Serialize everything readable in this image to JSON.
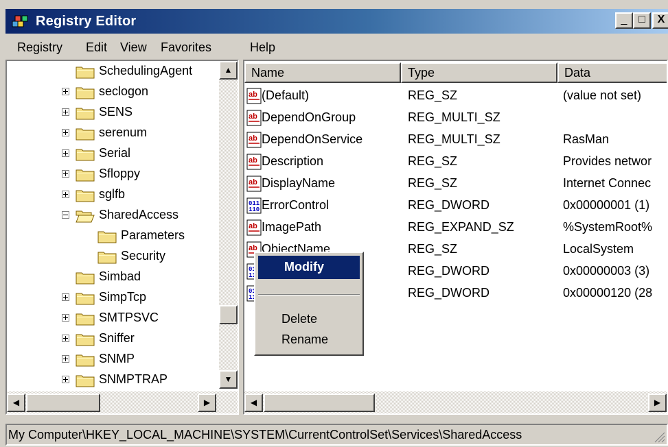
{
  "window": {
    "title": "Registry Editor",
    "minimize": "_",
    "maximize": "□",
    "close": "X"
  },
  "menu": [
    "Registry",
    "Edit",
    "View",
    "Favorites",
    "Help"
  ],
  "tree": [
    {
      "label": "SchedulingAgent",
      "expander": "none",
      "indent": 0,
      "open": false
    },
    {
      "label": "seclogon",
      "expander": "plus",
      "indent": 0,
      "open": false
    },
    {
      "label": "SENS",
      "expander": "plus",
      "indent": 0,
      "open": false
    },
    {
      "label": "serenum",
      "expander": "plus",
      "indent": 0,
      "open": false
    },
    {
      "label": "Serial",
      "expander": "plus",
      "indent": 0,
      "open": false
    },
    {
      "label": "Sfloppy",
      "expander": "plus",
      "indent": 0,
      "open": false
    },
    {
      "label": "sglfb",
      "expander": "plus",
      "indent": 0,
      "open": false
    },
    {
      "label": "SharedAccess",
      "expander": "minus",
      "indent": 0,
      "open": true
    },
    {
      "label": "Parameters",
      "expander": "none",
      "indent": 1,
      "open": false
    },
    {
      "label": "Security",
      "expander": "none",
      "indent": 1,
      "open": false
    },
    {
      "label": "Simbad",
      "expander": "none",
      "indent": 0,
      "open": false
    },
    {
      "label": "SimpTcp",
      "expander": "plus",
      "indent": 0,
      "open": false
    },
    {
      "label": "SMTPSVC",
      "expander": "plus",
      "indent": 0,
      "open": false
    },
    {
      "label": "Sniffer",
      "expander": "plus",
      "indent": 0,
      "open": false
    },
    {
      "label": "SNMP",
      "expander": "plus",
      "indent": 0,
      "open": false
    },
    {
      "label": "SNMPTRAP",
      "expander": "plus",
      "indent": 0,
      "open": false
    }
  ],
  "columns": {
    "name": "Name",
    "type": "Type",
    "data": "Data"
  },
  "values": [
    {
      "icon": "ab",
      "name": "(Default)",
      "type": "REG_SZ",
      "data": "(value not set)"
    },
    {
      "icon": "ab",
      "name": "DependOnGroup",
      "type": "REG_MULTI_SZ",
      "data": ""
    },
    {
      "icon": "ab",
      "name": "DependOnService",
      "type": "REG_MULTI_SZ",
      "data": "RasMan"
    },
    {
      "icon": "ab",
      "name": "Description",
      "type": "REG_SZ",
      "data": "Provides networ"
    },
    {
      "icon": "ab",
      "name": "DisplayName",
      "type": "REG_SZ",
      "data": "Internet Connec"
    },
    {
      "icon": "bin",
      "name": "ErrorControl",
      "type": "REG_DWORD",
      "data": "0x00000001 (1)"
    },
    {
      "icon": "ab",
      "name": "ImagePath",
      "type": "REG_EXPAND_SZ",
      "data": "%SystemRoot%"
    },
    {
      "icon": "ab",
      "name": "ObjectName",
      "type": "REG_SZ",
      "data": "LocalSystem"
    },
    {
      "icon": "bin",
      "name": "",
      "type": "REG_DWORD",
      "data": "0x00000003 (3)"
    },
    {
      "icon": "bin",
      "name": "",
      "type": "REG_DWORD",
      "data": "0x00000120 (28"
    }
  ],
  "context_menu": {
    "modify": "Modify",
    "delete": "Delete",
    "rename": "Rename"
  },
  "status": "My Computer\\HKEY_LOCAL_MACHINE\\SYSTEM\\CurrentControlSet\\Services\\SharedAccess",
  "colors": {
    "title_start": "#0a246a",
    "title_end": "#a6caf0",
    "face": "#d4d0c8",
    "highlight": "#0a246a",
    "folder": "#f4e08a",
    "icon_red": "#c00000",
    "icon_blue": "#0000c0"
  },
  "icons": [
    "registry-app-icon",
    "folder-icon",
    "string-value-icon",
    "binary-value-icon",
    "scroll-up-arrow-icon",
    "scroll-down-arrow-icon",
    "scroll-left-arrow-icon",
    "scroll-right-arrow-icon",
    "size-grip-icon"
  ]
}
